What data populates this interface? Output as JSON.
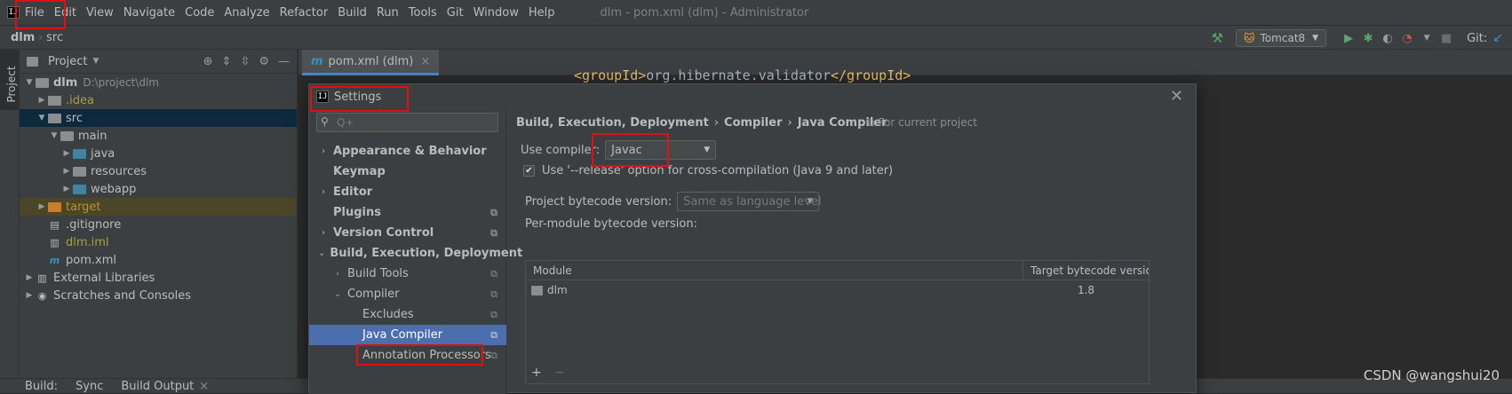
{
  "menubar": {
    "logo": "IJ",
    "items": [
      "File",
      "Edit",
      "View",
      "Navigate",
      "Code",
      "Analyze",
      "Refactor",
      "Build",
      "Run",
      "Tools",
      "Git",
      "Window",
      "Help"
    ],
    "title": "dlm - pom.xml (dlm) - Administrator"
  },
  "navbar": {
    "project": "dlm",
    "folder": "src",
    "run_config": "Tomcat8",
    "git_label": "Git:"
  },
  "left_stripe": {
    "label": "Project"
  },
  "project_panel": {
    "title": "Project",
    "root": {
      "name": "dlm",
      "path": "D:\\project\\dlm"
    },
    "tree": [
      {
        "label": ".idea",
        "indent": 1
      },
      {
        "label": "src",
        "indent": 1
      },
      {
        "label": "main",
        "indent": 2
      },
      {
        "label": "java",
        "indent": 3
      },
      {
        "label": "resources",
        "indent": 3
      },
      {
        "label": "webapp",
        "indent": 3
      },
      {
        "label": "target",
        "indent": 1
      },
      {
        "label": ".gitignore",
        "indent": 1
      },
      {
        "label": "dlm.iml",
        "indent": 1
      },
      {
        "label": "pom.xml",
        "indent": 1
      },
      {
        "label": "External Libraries",
        "indent": 0
      },
      {
        "label": "Scratches and Consoles",
        "indent": 0
      }
    ]
  },
  "editor": {
    "tab_label": "pom.xml (dlm)",
    "code_open": "<groupId>",
    "code_text": "org.hibernate.validator",
    "code_close": "</groupId>"
  },
  "bottom_bar": {
    "items": [
      "Build:",
      "Sync",
      "Build Output"
    ]
  },
  "watermark": "CSDN @wangshui20",
  "settings": {
    "title": "Settings",
    "search_placeholder": "Q+",
    "nav": [
      {
        "label": "Appearance & Behavior",
        "bold": true
      },
      {
        "label": "Keymap",
        "bold": true
      },
      {
        "label": "Editor",
        "bold": true
      },
      {
        "label": "Plugins",
        "bold": true
      },
      {
        "label": "Version Control",
        "bold": true
      },
      {
        "label": "Build, Execution, Deployment",
        "bold": true
      },
      {
        "label": "Build Tools",
        "bold": false
      },
      {
        "label": "Compiler",
        "bold": false
      },
      {
        "label": "Excludes",
        "bold": false
      },
      {
        "label": "Java Compiler",
        "bold": false,
        "selected": true
      },
      {
        "label": "Annotation Processors",
        "bold": false
      }
    ],
    "breadcrumb": [
      "Build, Execution, Deployment",
      "Compiler",
      "Java Compiler"
    ],
    "for_current_project": "For current project",
    "use_compiler_label": "Use compiler:",
    "use_compiler_value": "Javac",
    "release_option_label": "Use '--release' option for cross-compilation (Java 9 and later)",
    "release_option_checked": true,
    "bytecode_label": "Project bytecode version:",
    "bytecode_value": "Same as language level",
    "per_module_label": "Per-module bytecode version:",
    "table": {
      "headers": [
        "Module",
        "Target bytecode version"
      ],
      "rows": [
        {
          "module": "dlm",
          "target": "1.8"
        }
      ]
    },
    "add": "+",
    "remove": "−"
  },
  "colors": {
    "highlight_red": "#e01010",
    "selection_blue": "#4b6eaf",
    "accent_blue": "#4a88c7"
  }
}
